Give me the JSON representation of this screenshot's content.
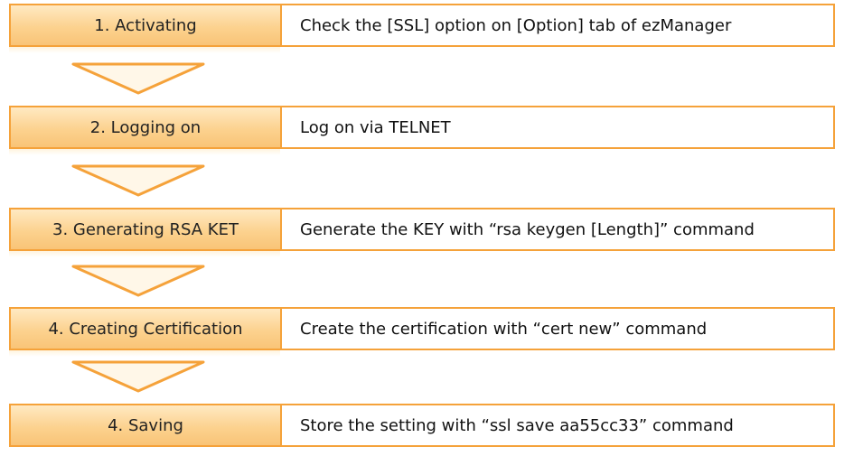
{
  "flow": {
    "steps": [
      {
        "label": "1. Activating",
        "description": "Check the [SSL] option on [Option] tab of ezManager"
      },
      {
        "label": "2. Logging on",
        "description": "Log on via TELNET"
      },
      {
        "label": "3. Generating RSA KET",
        "description": "Generate the KEY with “rsa keygen [Length]” command"
      },
      {
        "label": "4. Creating Certification",
        "description": "Create the certification with “cert new” command"
      },
      {
        "label": "4. Saving",
        "description": "Store the setting with “ssl save aa55cc33” command"
      }
    ]
  },
  "colors": {
    "accent": "#f5a23a",
    "label_fill": "#fcd28f",
    "arrow_fill": "#fff7e8"
  },
  "icons": {
    "arrow": "down-chevron-arrow-icon"
  }
}
